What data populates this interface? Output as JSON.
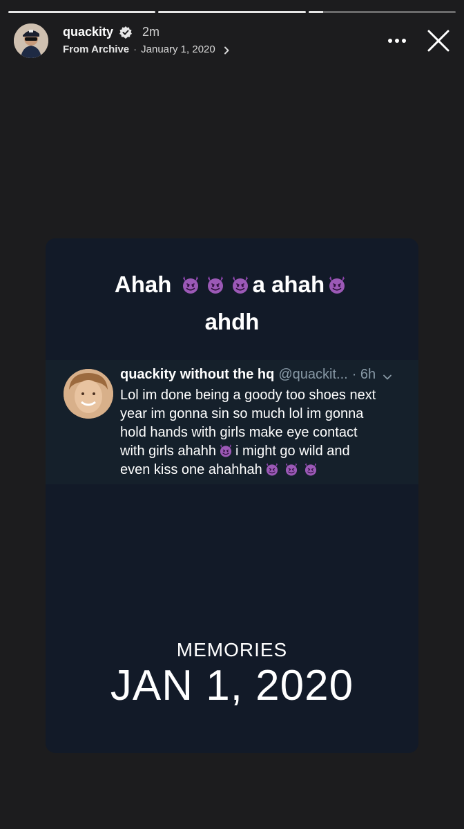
{
  "progress": [
    {
      "fill": 1.0
    },
    {
      "fill": 1.0
    },
    {
      "fill": 0.1
    }
  ],
  "header": {
    "username": "quackity",
    "time": "2m",
    "from_label": "From Archive",
    "separator": "·",
    "date": "January 1, 2020",
    "icons": {
      "verified": "verified-badge-icon",
      "more": "more-options-icon",
      "close": "close-icon",
      "chevron": "chevron-right-icon"
    }
  },
  "story": {
    "caption_line1_a": "Ahah",
    "caption_line1_b": "a ahah",
    "caption_line2": "ahdh",
    "tweet": {
      "name": "quackity without the hq",
      "handle": "@quackit...",
      "time": "· 6h",
      "line1": "Lol im done being a goody too shoes next",
      "line2": "year im gonna sin so much lol im gonna",
      "line3": "hold hands with girls make eye contact",
      "line4a": "with girls ahahh",
      "line4b": "i might go wild and",
      "line5": "even kiss one ahahhah"
    },
    "memories_label": "MEMORIES",
    "memories_date": "JAN 1, 2020"
  },
  "colors": {
    "background": "#1c1c1e",
    "card": "#121a28",
    "tweet_bg": "#15202b",
    "devil_emoji": "#8e44ad",
    "handle_gray": "#8899a6"
  }
}
